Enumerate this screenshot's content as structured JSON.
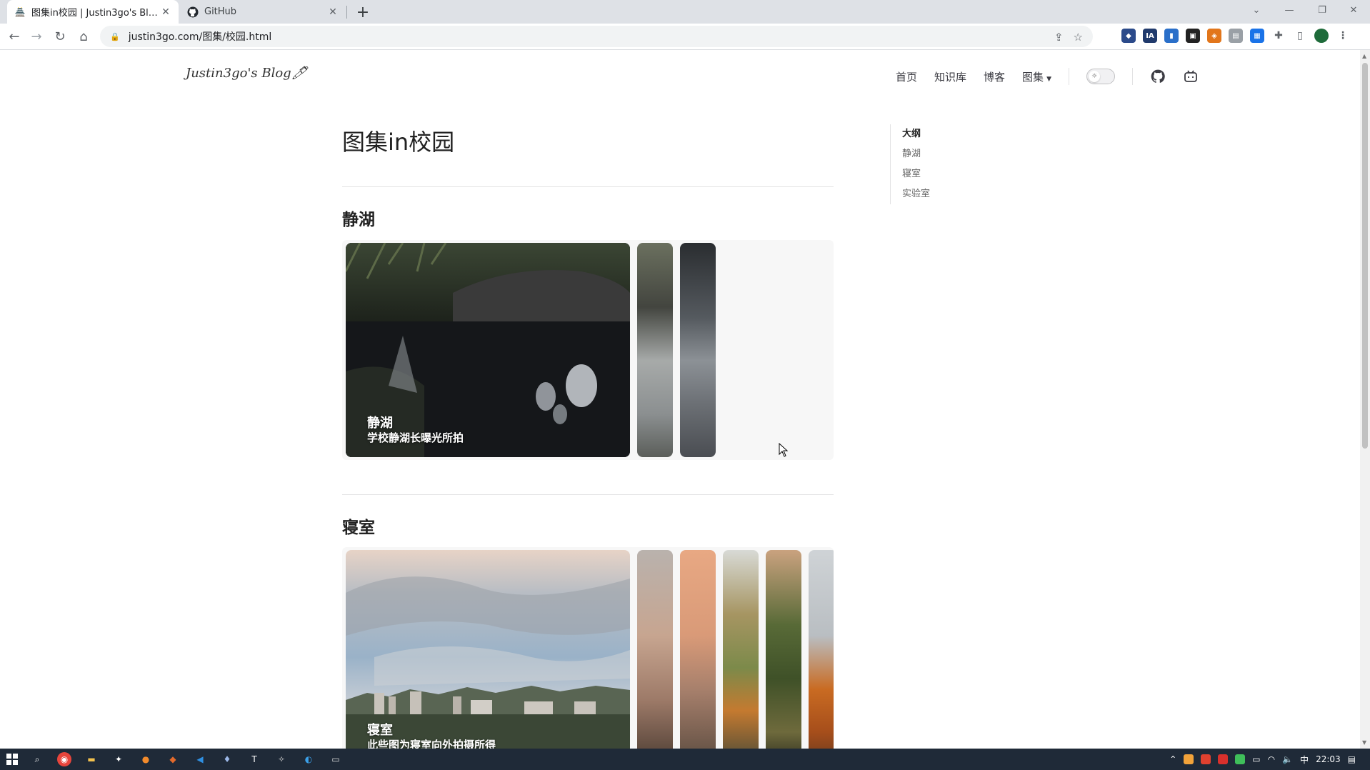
{
  "browser": {
    "tabs": [
      {
        "title": "图集in校园 | Justin3go's Blog🖊",
        "active": true
      },
      {
        "title": "GitHub",
        "active": false
      }
    ],
    "url": "justin3go.com/图集/校园.html"
  },
  "site": {
    "logo": "Justin3go's Blog🖊",
    "nav": {
      "home": "首页",
      "kb": "知识库",
      "blog": "博客",
      "gallery": "图集"
    }
  },
  "page": {
    "title": "图集in校园",
    "sections": [
      {
        "heading": "静湖",
        "caption_title": "静湖",
        "caption_sub": "学校静湖长曝光所拍"
      },
      {
        "heading": "寝室",
        "caption_title": "寝室",
        "caption_sub": "此些图为寝室向外拍摄所得"
      }
    ]
  },
  "outline": {
    "title": "大纲",
    "items": [
      "静湖",
      "寝室",
      "实验室"
    ]
  },
  "taskbar": {
    "ime": "中",
    "time": "22:03"
  },
  "colors": {
    "accent": "#3c3c43",
    "tabbar": "#dee1e6",
    "taskbar": "#1f2a38"
  }
}
